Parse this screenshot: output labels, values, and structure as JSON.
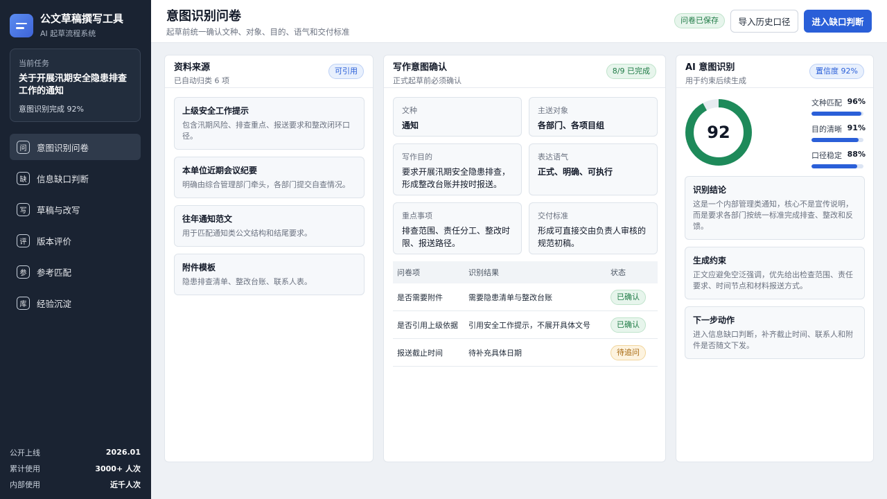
{
  "sidebar": {
    "app_title": "公文草稿撰写工具",
    "app_sub": "AI 起草流程系统",
    "task": {
      "label": "当前任务",
      "title": "关于开展汛期安全隐患排查工作的通知",
      "progress": "意图识别完成 92%"
    },
    "nav": [
      {
        "icon": "问",
        "label": "意图识别问卷",
        "active": true
      },
      {
        "icon": "缺",
        "label": "信息缺口判断"
      },
      {
        "icon": "写",
        "label": "草稿与改写"
      },
      {
        "icon": "评",
        "label": "版本评价"
      },
      {
        "icon": "参",
        "label": "参考匹配"
      },
      {
        "icon": "库",
        "label": "经验沉淀"
      }
    ],
    "stats": [
      {
        "k": "公开上线",
        "v": "2026.01"
      },
      {
        "k": "累计使用",
        "v": "3000+ 人次"
      },
      {
        "k": "内部使用",
        "v": "近千人次"
      }
    ]
  },
  "header": {
    "title": "意图识别问卷",
    "subtitle": "起草前统一确认文种、对象、目的、语气和交付标准",
    "saved": "问卷已保存",
    "import_btn": "导入历史口径",
    "primary_btn": "进入缺口判断"
  },
  "sources": {
    "title": "资料来源",
    "sub": "已自动归类 6 项",
    "badge": "可引用",
    "items": [
      {
        "title": "上级安全工作提示",
        "desc": "包含汛期风险、排查重点、报送要求和整改闭环口径。"
      },
      {
        "title": "本单位近期会议纪要",
        "desc": "明确由综合管理部门牵头，各部门提交自查情况。"
      },
      {
        "title": "往年通知范文",
        "desc": "用于匹配通知类公文结构和结尾要求。"
      },
      {
        "title": "附件模板",
        "desc": "隐患排查清单、整改台账、联系人表。"
      }
    ]
  },
  "intent": {
    "title": "写作意图确认",
    "sub": "正式起草前必须确认",
    "badge": "8/9 已完成",
    "fields": [
      {
        "k": "文种",
        "v": "通知"
      },
      {
        "k": "主送对象",
        "v": "各部门、各项目组"
      },
      {
        "k": "写作目的",
        "v": "要求开展汛期安全隐患排查，形成整改台账并按时报送。"
      },
      {
        "k": "表达语气",
        "v": "正式、明确、可执行"
      },
      {
        "k": "重点事项",
        "v": "排查范围、责任分工、整改时限、报送路径。"
      },
      {
        "k": "交付标准",
        "v": "形成可直接交由负责人审核的规范初稿。"
      }
    ],
    "table": {
      "headers": [
        "问卷项",
        "识别结果",
        "状态"
      ],
      "rows": [
        {
          "item": "是否需要附件",
          "result": "需要隐患清单与整改台账",
          "status": "已确认"
        },
        {
          "item": "是否引用上级依据",
          "result": "引用安全工作提示，不展开具体文号",
          "status": "已确认"
        },
        {
          "item": "报送截止时间",
          "result": "待补充具体日期",
          "status": "待追问"
        }
      ]
    }
  },
  "ai": {
    "title": "AI 意图识别",
    "sub": "用于约束后续生成",
    "badge": "置信度 92%",
    "score": 92,
    "score_label": "92",
    "metrics": [
      {
        "k": "文种匹配",
        "v": "96%",
        "value": 0.96
      },
      {
        "k": "目的清晰",
        "v": "91%",
        "value": 0.91
      },
      {
        "k": "口径稳定",
        "v": "88%",
        "value": 0.88
      }
    ],
    "cards": [
      {
        "title": "识别结论",
        "desc": "这是一个内部管理类通知，核心不是宣传说明，而是要求各部门按统一标准完成排查、整改和反馈。"
      },
      {
        "title": "生成约束",
        "desc": "正文应避免空泛强调，优先给出检查范围、责任要求、时间节点和材料报送方式。"
      },
      {
        "title": "下一步动作",
        "desc": "进入信息缺口判断，补齐截止时间、联系人和附件是否随文下发。"
      }
    ],
    "colors": {
      "ring": "#1e8a5a",
      "ring_track": "#e7ecf1"
    }
  }
}
